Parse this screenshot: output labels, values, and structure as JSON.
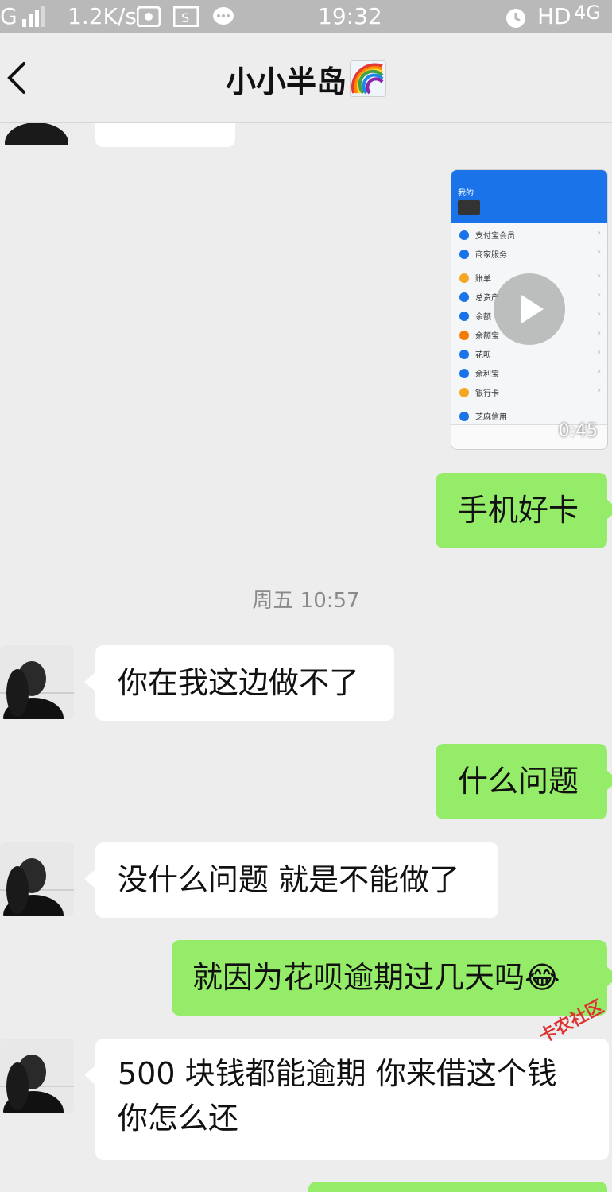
{
  "status_bar": {
    "network": "G",
    "speed": "1.2K/s",
    "time": "19:32",
    "hd": "HD",
    "net_type": "4G"
  },
  "header": {
    "title": "小小半岛"
  },
  "messages": {
    "m1": "手机好卡",
    "ts1": "周五 10:57",
    "m2": "你在我这边做不了",
    "m3": "什么问题",
    "m4": "没什么问题 就是不能做了",
    "m5": "就因为花呗逾期过几天吗😂",
    "m6_line1": "500 块钱都能逾期  你来借这个钱",
    "m6_line2": "你怎么还"
  },
  "video": {
    "duration": "0:45",
    "title": "我的",
    "rows": [
      "支付宝会员",
      "商家服务",
      "账单",
      "总资产",
      "余额",
      "余额宝",
      "花呗",
      "余利宝",
      "银行卡",
      "芝麻信用"
    ]
  },
  "watermark": "卡农社区",
  "colors": {
    "incoming_bubble": "#ffffff",
    "outgoing_bubble": "#95ec69",
    "background": "#ededed"
  }
}
